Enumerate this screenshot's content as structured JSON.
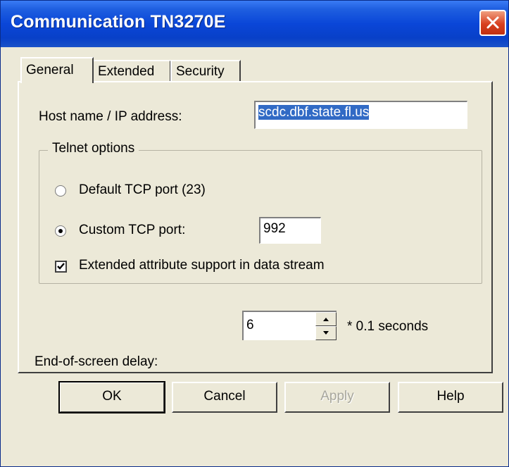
{
  "window": {
    "title": "Communication TN3270E"
  },
  "tabs": [
    {
      "label": "General",
      "active": true
    },
    {
      "label": "Extended",
      "active": false
    },
    {
      "label": "Security",
      "active": false
    }
  ],
  "general": {
    "host_label": "Host name / IP address:",
    "host_value": "scdc.dbf.state.fl.us",
    "telnet_group_label": "Telnet options",
    "default_port_label": "Default TCP port (23)",
    "default_port_selected": false,
    "custom_port_label": "Custom TCP port:",
    "custom_port_selected": true,
    "custom_port_value": "992",
    "ext_attr_label": "Extended attribute support in data stream",
    "ext_attr_checked": true,
    "delay_label": "End-of-screen delay:",
    "delay_value": "6",
    "delay_unit": "* 0.1 seconds"
  },
  "buttons": {
    "ok": "OK",
    "cancel": "Cancel",
    "apply": "Apply",
    "help": "Help"
  },
  "colors": {
    "title_bar": "#0a46d8",
    "selection": "#316ac5",
    "close": "#d84020",
    "dialog": "#ece9d8"
  }
}
